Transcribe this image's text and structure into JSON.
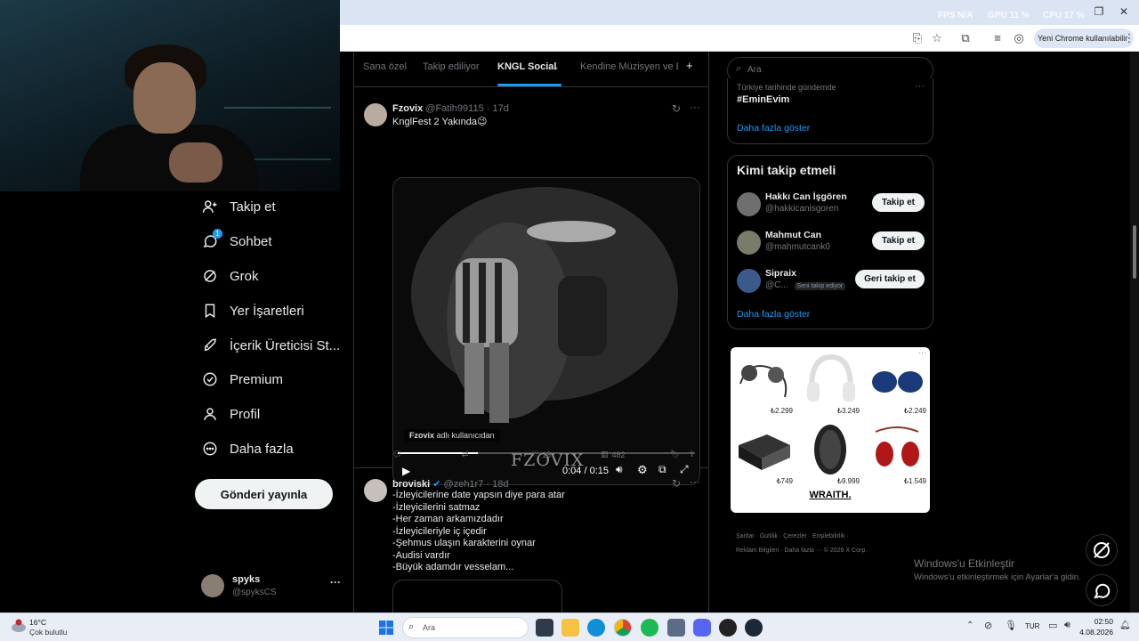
{
  "window": {
    "fps": "FPS N/A",
    "gpu": "GPU 11 %",
    "cpu": "CPU 17 %",
    "chrome_pill": "Yeni Chrome kullanılabilir"
  },
  "nav": {
    "items": [
      {
        "label": "Takip et",
        "icon": "person-add-icon"
      },
      {
        "label": "Sohbet",
        "icon": "chat-icon",
        "badge": "1"
      },
      {
        "label": "Grok",
        "icon": "grok-icon"
      },
      {
        "label": "Yer İşaretleri",
        "icon": "bookmark-icon"
      },
      {
        "label": "İçerik Üreticisi St...",
        "icon": "rocket-icon"
      },
      {
        "label": "Premium",
        "icon": "verified-icon"
      },
      {
        "label": "Profil",
        "icon": "person-icon"
      },
      {
        "label": "Daha fazla",
        "icon": "more-circle-icon"
      }
    ],
    "post_button": "Gönderi yayınla",
    "profile": {
      "name": "spyks",
      "handle": "@spyksCS",
      "more": "···"
    }
  },
  "tabs": [
    {
      "label": "Sana özel"
    },
    {
      "label": "Takip ediliyor"
    },
    {
      "label": "KNGL Social",
      "active": true
    },
    {
      "label": "Kendine Müzisyen ve Ba"
    }
  ],
  "posts": [
    {
      "name": "Fzovix",
      "handle": "@Fatih99115",
      "time": "· 17d",
      "text": "KnglFest 2 Yakında😉",
      "video": {
        "attribution_user": "Fzovix",
        "attribution_rest": " adlı kullanıcıdan",
        "watermark": "FZOVIX",
        "time": "0:04 / 0:15",
        "progress": 0.27
      },
      "likes": "18",
      "views": "482"
    },
    {
      "name": "broviski",
      "handle": "@zeh1r7",
      "time": "· 18d",
      "lines": [
        "-İzleyicilerine date yapsın diye para atar",
        "-İzleyicilerini satmaz",
        "-Her zaman arkamızdadır",
        "-İzleyicileriyle iç içedir",
        "-Şehmus ulaşın karakterini oynar",
        "-Audisi vardır",
        "-Büyük adamdır vesselam..."
      ]
    }
  ],
  "right": {
    "search_placeholder": "Ara",
    "trend_context": "Türkiye tarihinde gündemde",
    "trend_tag": "#EminEvim",
    "show_more": "Daha fazla göster",
    "who_to_follow_title": "Kimi takip etmeli",
    "suggestions": [
      {
        "name": "Hakkı Can İşgören",
        "handle": "@hakkicanisgoren",
        "button": "Takip et"
      },
      {
        "name": "Mahmut Can",
        "handle": "@mahmutcank0",
        "button": "Takip et"
      },
      {
        "name": "Sipraix",
        "handle": "@C...",
        "badge": "Seni takip ediyor",
        "button": "Geri takip et"
      }
    ],
    "show_more_2": "Daha fazla göster",
    "ad": {
      "prices": [
        "₺2.299",
        "₺3.249",
        "₺2.249",
        "₺749",
        "₺9.999",
        "₺1.549"
      ],
      "brand": "WRAITH."
    },
    "footer_line1": "Şartlar · Gizlilik · Çerezler · Erişilebilirlik ·",
    "footer_line2": "Reklam Bilgileri · Daha fazla ··· © 2026 X Corp."
  },
  "activation": {
    "title": "Windows'u Etkinleştir",
    "subtitle": "Windows'u etkinleştirmek için Ayarlar'a gidin."
  },
  "taskbar": {
    "weather_temp": "16°C",
    "weather_desc": "Çok bulutlu",
    "search": "Ara",
    "lang": "TUR",
    "time": "02:50",
    "date": "4.08.2026"
  }
}
